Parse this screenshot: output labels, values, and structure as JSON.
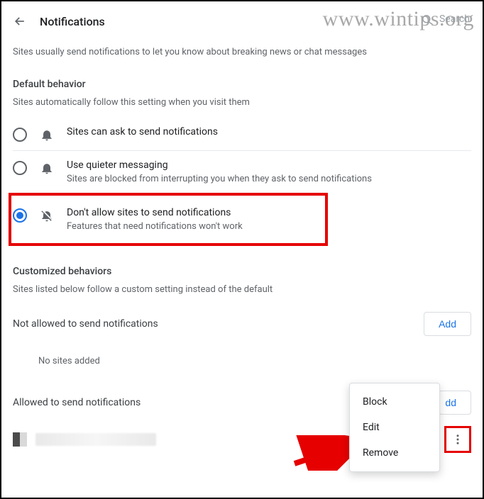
{
  "header": {
    "title": "Notifications",
    "search_placeholder": "Search"
  },
  "watermark": "www.wintips.org",
  "intro": "Sites usually send notifications to let you know about breaking news or chat messages",
  "default_behavior": {
    "title": "Default behavior",
    "subtitle": "Sites automatically follow this setting when you visit them",
    "options": [
      {
        "label": "Sites can ask to send notifications",
        "sub": "",
        "selected": false
      },
      {
        "label": "Use quieter messaging",
        "sub": "Sites are blocked from interrupting you when they ask to send notifications",
        "selected": false
      },
      {
        "label": "Don't allow sites to send notifications",
        "sub": "Features that need notifications won't work",
        "selected": true
      }
    ]
  },
  "customized": {
    "title": "Customized behaviors",
    "subtitle": "Sites listed below follow a custom setting instead of the default"
  },
  "not_allowed": {
    "title": "Not allowed to send notifications",
    "add_label": "Add",
    "empty": "No sites added"
  },
  "allowed": {
    "title": "Allowed to send notifications",
    "add_label": "dd"
  },
  "context_menu": {
    "block": "Block",
    "edit": "Edit",
    "remove": "Remove"
  }
}
